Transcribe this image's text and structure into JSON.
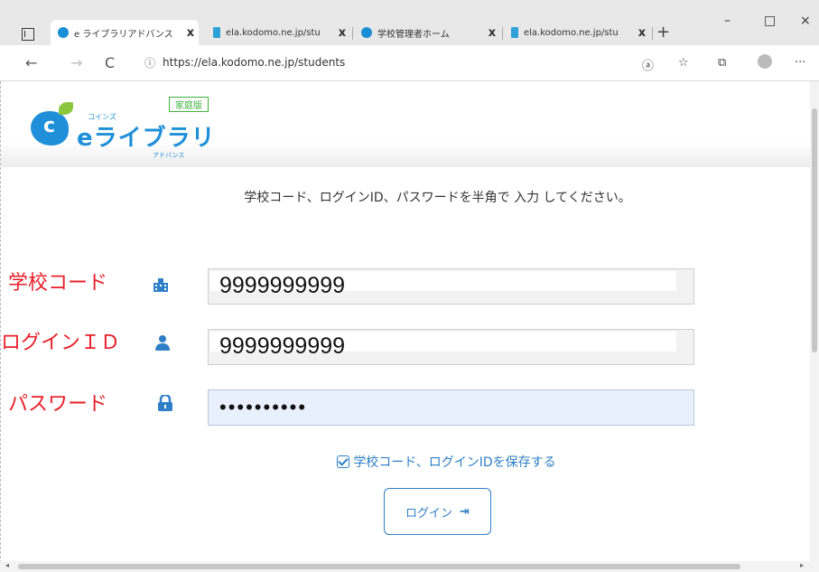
{
  "browser": {
    "tabs": [
      {
        "label": "e ライブラリアドバンス",
        "favicon": "elibrary-icon"
      },
      {
        "label": "ela.kodomo.ne.jp/stu",
        "favicon": "bing-icon"
      },
      {
        "label": "学校管理者ホーム",
        "favicon": "elibrary-icon"
      },
      {
        "label": "ela.kodomo.ne.jp/stu",
        "favicon": "bing-icon"
      }
    ],
    "close_glyph": "x",
    "new_tab_glyph": "+",
    "window_controls": {
      "minimize": "–",
      "maximize": "□",
      "close": "×"
    },
    "nav": {
      "back": "←",
      "forward": "→",
      "reload": "C"
    },
    "url": "https://ela.kodomo.ne.jp/students",
    "toolbar": {
      "read_aloud": "ⓐ",
      "favorites": "☆",
      "collections": "⧉",
      "more": "···"
    }
  },
  "header": {
    "badge": "家庭版",
    "logo_sub": "コインズ",
    "logo_main": "eライブラリ",
    "logo_adv": "アドバンス"
  },
  "instruction": "学校コード、ログインID、パスワードを半角で 入力 してください。",
  "annotations": {
    "school_code": "学校コード",
    "login_id": "ログインＩＤ",
    "password": "パスワード"
  },
  "fields": {
    "school_code": "9999999999",
    "login_id": "9999999999",
    "password": "••••••••••"
  },
  "save_label": "学校コード、ログインIDを保存する",
  "login_button": "ログイン",
  "colors": {
    "accent": "#2e7fc7",
    "annotation": "#e8202a",
    "badge": "#3bb23b"
  }
}
